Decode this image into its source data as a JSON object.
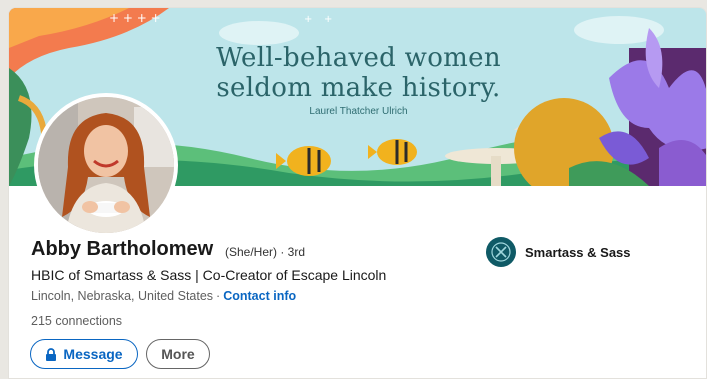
{
  "banner": {
    "quote_line1": "Well-behaved women",
    "quote_line2": "seldom make history.",
    "quote_author": "Laurel Thatcher Ulrich"
  },
  "profile": {
    "name": "Abby Bartholomew",
    "pronouns_degree": "(She/Her) · 3rd",
    "headline": "HBIC of Smartass & Sass | Co-Creator of Escape Lincoln",
    "location": "Lincoln, Nebraska, United States",
    "location_separator": "·",
    "contact_link": "Contact info",
    "connections": "215 connections"
  },
  "actions": {
    "message_label": "Message",
    "more_label": "More"
  },
  "company": {
    "name": "Smartass & Sass"
  },
  "colors": {
    "link_blue": "#0a66c2",
    "banner_teal": "#bfe6ea",
    "quote_text": "#2b6469"
  },
  "icons": {
    "lock": "lock-icon",
    "company_logo": "company-logo-icon"
  }
}
